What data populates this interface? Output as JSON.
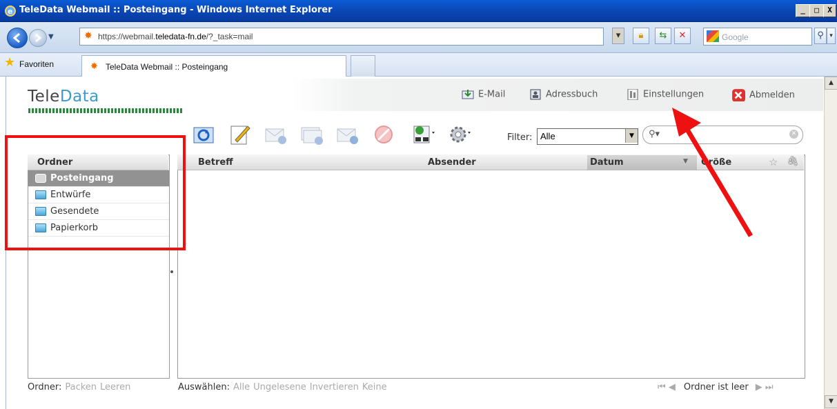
{
  "window": {
    "title": "TeleData Webmail :: Posteingang - Windows Internet Explorer",
    "controls": [
      "_",
      "□",
      "X"
    ]
  },
  "browser": {
    "url_prefix": "https://webmail.",
    "url_domain": "teledata-fn.de",
    "url_path": "/?_task=mail",
    "search_provider": "Google",
    "favorites_label": "Favoriten",
    "tab_title": "TeleData Webmail :: Posteingang"
  },
  "logo": {
    "part1": "Tele",
    "part2": "Data",
    "accent_color": "#3b9ad2"
  },
  "topnav": {
    "mail": "E-Mail",
    "addressbook": "Adressbuch",
    "settings": "Einstellungen",
    "logout": "Abmelden"
  },
  "toolbar": {
    "icons": [
      "refresh-icon",
      "compose-icon",
      "reply-icon",
      "reply-all-icon",
      "forward-icon",
      "delete-icon",
      "mark-icon",
      "settings-gear-icon"
    ],
    "filter_label": "Filter:",
    "filter_value": "Alle"
  },
  "folders": {
    "header": "Ordner",
    "items": [
      {
        "label": "Posteingang",
        "selected": true
      },
      {
        "label": "Entwürfe",
        "selected": false
      },
      {
        "label": "Gesendete",
        "selected": false
      },
      {
        "label": "Papierkorb",
        "selected": false
      }
    ],
    "footer_label": "Ordner:",
    "footer_actions": [
      "Packen",
      "Leeren"
    ]
  },
  "messages": {
    "columns": {
      "subject": "Betreff",
      "sender": "Absender",
      "date": "Datum",
      "size": "Größe"
    },
    "select_label": "Auswählen:",
    "select_options": [
      "Alle",
      "Ungelesene",
      "Invertieren",
      "Keine"
    ],
    "status": "Ordner ist leer"
  },
  "annotation_color": "#ee1111"
}
